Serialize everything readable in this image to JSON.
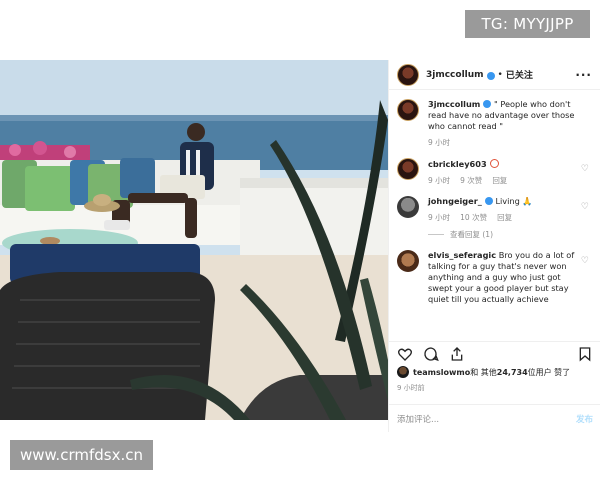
{
  "watermarks": {
    "top": "TG: MYYJJPP",
    "bottom": "www.crmfdsx.cn"
  },
  "post": {
    "header": {
      "username": "3jmccollum",
      "separator": "•",
      "follow_label": "已关注",
      "more_label": "···"
    },
    "comments": [
      {
        "username": "3jmccollum",
        "text": "\" People who don't read have no advantage over those who cannot read \"",
        "time": "9 小时",
        "likes": "",
        "reply_label": ""
      },
      {
        "username": "cbrickley603",
        "text": "",
        "time": "9 小时",
        "likes": "9 次赞",
        "reply_label": "回复"
      },
      {
        "username": "johngeiger_",
        "text": "Living 🙏",
        "time": "9 小时",
        "likes": "10 次赞",
        "reply_label": "回复",
        "view_replies": "查看回复 (1)"
      },
      {
        "username": "elvis_seferagic",
        "text": "Bro you do a lot of talking for a guy that's never won anything and a guy who just got swept your a good player but stay quiet till you actually achieve",
        "time": "",
        "likes": "",
        "reply_label": ""
      }
    ],
    "likes_line": {
      "user": "teamslowmo",
      "mid": " 和 其他 ",
      "count": "24,734",
      "suffix": " 位用户 赞了"
    },
    "time": "9 小时前",
    "add_comment_placeholder": "添加评论...",
    "post_button": "发布"
  },
  "colors": {
    "verified": "#3897f0",
    "muted": "#8e8e8e",
    "text": "#262626"
  }
}
